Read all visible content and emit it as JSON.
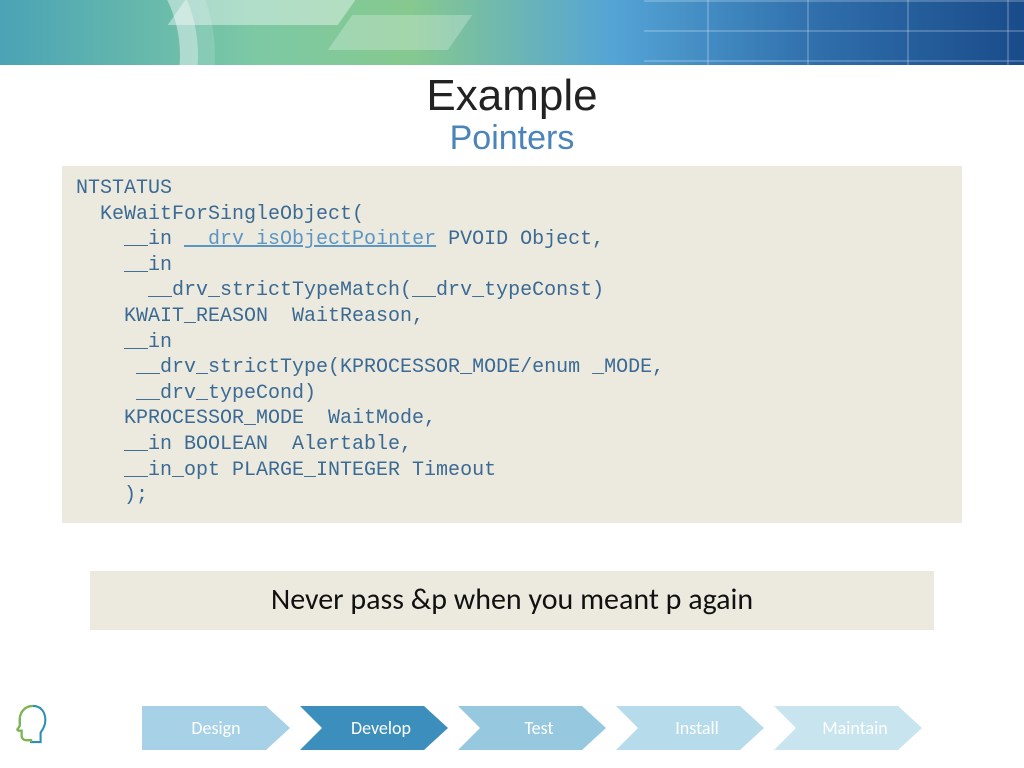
{
  "title": "Example",
  "subtitle": "Pointers",
  "code": {
    "l00": "NTSTATUS",
    "l01": "  KeWaitForSingleObject(",
    "l02a": "    __in ",
    "l02b": "__drv_isObjectPointer",
    "l02c": " PVOID Object,",
    "l03": "    __in",
    "l04": "      __drv_strictTypeMatch(__drv_typeConst)",
    "l05": "    KWAIT_REASON  WaitReason,",
    "l06": "    __in",
    "l07": "     __drv_strictType(KPROCESSOR_MODE/enum _MODE,",
    "l08": "     __drv_typeCond)",
    "l09": "    KPROCESSOR_MODE  WaitMode,",
    "l10": "    __in BOOLEAN  Alertable,",
    "l11": "    __in_opt PLARGE_INTEGER Timeout",
    "l12": "    );"
  },
  "callout": "Never pass &p when you meant p again",
  "arrows": [
    {
      "label": "Design",
      "color": "#a6d1e6"
    },
    {
      "label": "Develop",
      "color": "#3c8fbd"
    },
    {
      "label": "Test",
      "color": "#96c9e0"
    },
    {
      "label": "Install",
      "color": "#b6dbea"
    },
    {
      "label": "Maintain",
      "color": "#c7e4ef"
    }
  ]
}
